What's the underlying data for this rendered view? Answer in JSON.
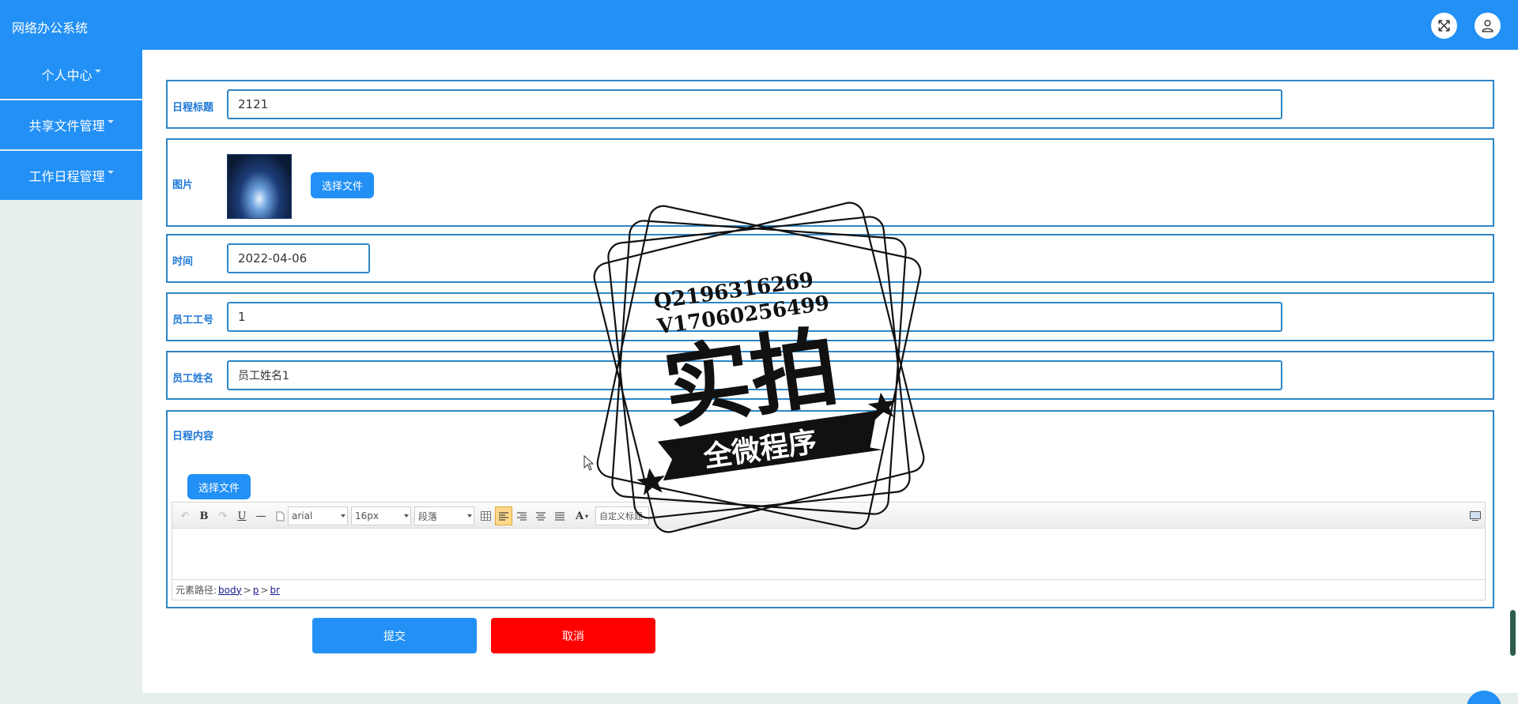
{
  "header": {
    "app_title": "网络办公系统",
    "fullscreen_icon": "fullscreen-icon",
    "user_icon": "user-icon",
    "accent": "#2290f5"
  },
  "sidebar": {
    "items": [
      {
        "label": "个人中心"
      },
      {
        "label": "共享文件管理"
      },
      {
        "label": "工作日程管理"
      }
    ]
  },
  "form": {
    "title_label": "日程标题",
    "title_value": "2121",
    "image_label": "图片",
    "choose_file_label": "选择文件",
    "time_label": "时间",
    "time_value": "2022-04-06",
    "employee_id_label": "员工工号",
    "employee_id_value": "1",
    "employee_name_label": "员工姓名",
    "employee_name_value": "员工姓名1",
    "content_label": "日程内容",
    "content_choose_file_label": "选择文件"
  },
  "editor": {
    "toolbar": {
      "bold": "B",
      "underline": "U",
      "font_family": "arial",
      "font_size": "16px",
      "paragraph": "段落",
      "font_color": "A",
      "custom_title": "自定义标题"
    },
    "status_prefix": "元素路径:",
    "path": [
      "body",
      "p",
      "br"
    ],
    "path_sep": ">"
  },
  "actions": {
    "submit_label": "提交",
    "cancel_label": "取消",
    "submit_color": "#2290f5",
    "cancel_color": "#ff0000"
  },
  "watermark": {
    "line1": "Q2196316269",
    "line2": "V17060256499",
    "main": "实拍",
    "ribbon": "全微程序"
  }
}
